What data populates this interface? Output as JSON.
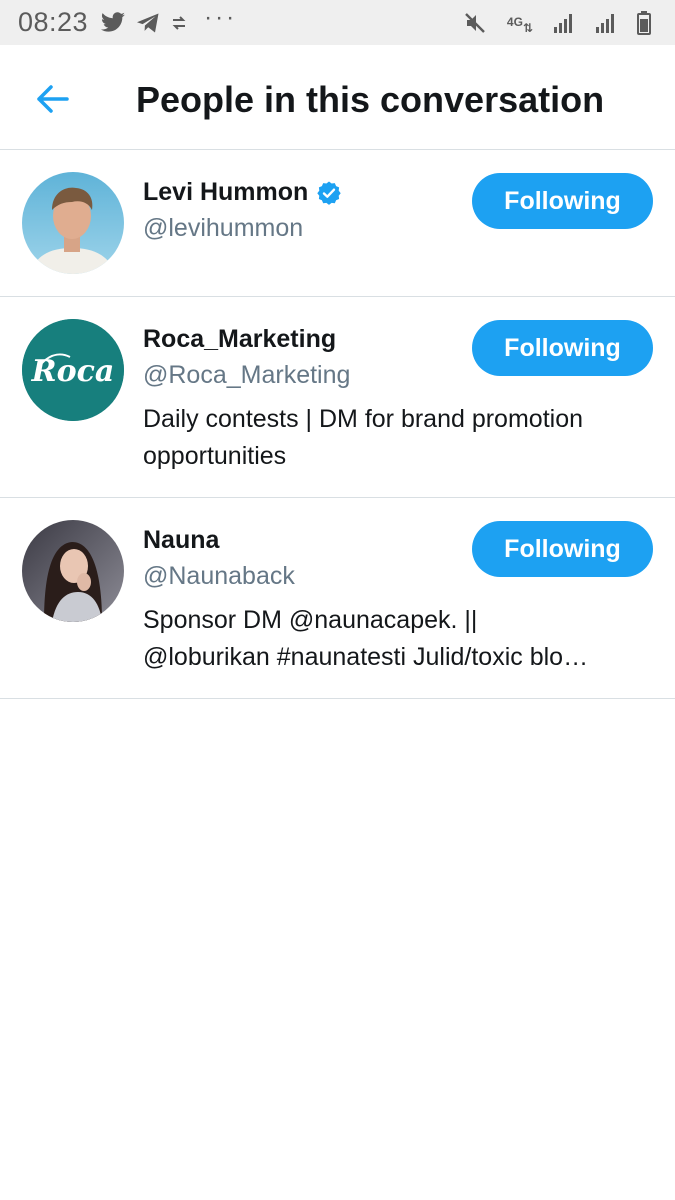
{
  "status_bar": {
    "time": "08:23",
    "icons_left": [
      "twitter-icon",
      "telegram-icon",
      "sync-icon"
    ],
    "more": "···",
    "network": "4G",
    "icons_right": [
      "mute-icon",
      "4g-data-icon",
      "signal-icon",
      "signal-icon",
      "battery-icon"
    ]
  },
  "header": {
    "title": "People in this conversation",
    "back_icon": "arrow-left-icon"
  },
  "colors": {
    "accent": "#1da1f2",
    "text_primary": "#14171a",
    "text_secondary": "#657786",
    "divider": "#d9dfe3"
  },
  "people": [
    {
      "name": "Levi Hummon",
      "verified": true,
      "handle": "@levihummon",
      "bio_lines": [],
      "button_label": "Following",
      "avatar": "user-photo-avatar"
    },
    {
      "name": "Roca_Marketing",
      "verified": false,
      "handle": "@Roca_Marketing",
      "bio_lines": [
        "Daily contests | DM for brand promotion",
        "opportunities"
      ],
      "button_label": "Following",
      "avatar": "roca-logo-avatar",
      "avatar_text": "Roca"
    },
    {
      "name": "Nauna",
      "verified": false,
      "handle": "@Naunaback",
      "bio_lines": [
        "Sponsor DM @naunacapek. ||",
        "@loburikan #naunatesti Julid/toxic blo…"
      ],
      "button_label": "Following",
      "avatar": "user-photo-avatar"
    }
  ]
}
